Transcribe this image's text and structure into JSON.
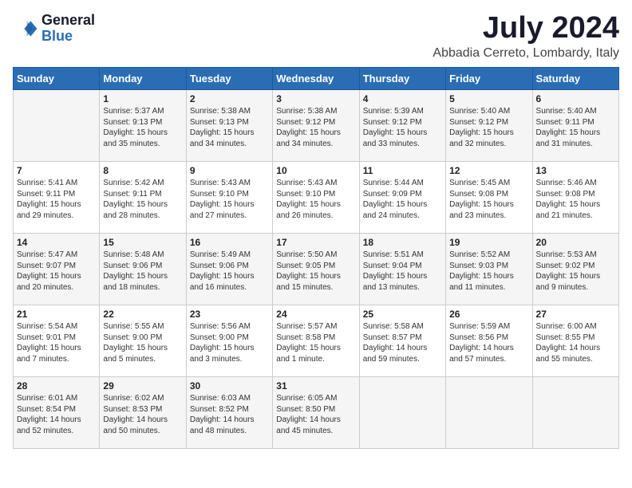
{
  "header": {
    "logo_general": "General",
    "logo_blue": "Blue",
    "month_year": "July 2024",
    "location": "Abbadia Cerreto, Lombardy, Italy"
  },
  "days_of_week": [
    "Sunday",
    "Monday",
    "Tuesday",
    "Wednesday",
    "Thursday",
    "Friday",
    "Saturday"
  ],
  "weeks": [
    [
      {
        "day": "",
        "info": ""
      },
      {
        "day": "1",
        "info": "Sunrise: 5:37 AM\nSunset: 9:13 PM\nDaylight: 15 hours\nand 35 minutes."
      },
      {
        "day": "2",
        "info": "Sunrise: 5:38 AM\nSunset: 9:13 PM\nDaylight: 15 hours\nand 34 minutes."
      },
      {
        "day": "3",
        "info": "Sunrise: 5:38 AM\nSunset: 9:12 PM\nDaylight: 15 hours\nand 34 minutes."
      },
      {
        "day": "4",
        "info": "Sunrise: 5:39 AM\nSunset: 9:12 PM\nDaylight: 15 hours\nand 33 minutes."
      },
      {
        "day": "5",
        "info": "Sunrise: 5:40 AM\nSunset: 9:12 PM\nDaylight: 15 hours\nand 32 minutes."
      },
      {
        "day": "6",
        "info": "Sunrise: 5:40 AM\nSunset: 9:11 PM\nDaylight: 15 hours\nand 31 minutes."
      }
    ],
    [
      {
        "day": "7",
        "info": "Sunrise: 5:41 AM\nSunset: 9:11 PM\nDaylight: 15 hours\nand 29 minutes."
      },
      {
        "day": "8",
        "info": "Sunrise: 5:42 AM\nSunset: 9:11 PM\nDaylight: 15 hours\nand 28 minutes."
      },
      {
        "day": "9",
        "info": "Sunrise: 5:43 AM\nSunset: 9:10 PM\nDaylight: 15 hours\nand 27 minutes."
      },
      {
        "day": "10",
        "info": "Sunrise: 5:43 AM\nSunset: 9:10 PM\nDaylight: 15 hours\nand 26 minutes."
      },
      {
        "day": "11",
        "info": "Sunrise: 5:44 AM\nSunset: 9:09 PM\nDaylight: 15 hours\nand 24 minutes."
      },
      {
        "day": "12",
        "info": "Sunrise: 5:45 AM\nSunset: 9:08 PM\nDaylight: 15 hours\nand 23 minutes."
      },
      {
        "day": "13",
        "info": "Sunrise: 5:46 AM\nSunset: 9:08 PM\nDaylight: 15 hours\nand 21 minutes."
      }
    ],
    [
      {
        "day": "14",
        "info": "Sunrise: 5:47 AM\nSunset: 9:07 PM\nDaylight: 15 hours\nand 20 minutes."
      },
      {
        "day": "15",
        "info": "Sunrise: 5:48 AM\nSunset: 9:06 PM\nDaylight: 15 hours\nand 18 minutes."
      },
      {
        "day": "16",
        "info": "Sunrise: 5:49 AM\nSunset: 9:06 PM\nDaylight: 15 hours\nand 16 minutes."
      },
      {
        "day": "17",
        "info": "Sunrise: 5:50 AM\nSunset: 9:05 PM\nDaylight: 15 hours\nand 15 minutes."
      },
      {
        "day": "18",
        "info": "Sunrise: 5:51 AM\nSunset: 9:04 PM\nDaylight: 15 hours\nand 13 minutes."
      },
      {
        "day": "19",
        "info": "Sunrise: 5:52 AM\nSunset: 9:03 PM\nDaylight: 15 hours\nand 11 minutes."
      },
      {
        "day": "20",
        "info": "Sunrise: 5:53 AM\nSunset: 9:02 PM\nDaylight: 15 hours\nand 9 minutes."
      }
    ],
    [
      {
        "day": "21",
        "info": "Sunrise: 5:54 AM\nSunset: 9:01 PM\nDaylight: 15 hours\nand 7 minutes."
      },
      {
        "day": "22",
        "info": "Sunrise: 5:55 AM\nSunset: 9:00 PM\nDaylight: 15 hours\nand 5 minutes."
      },
      {
        "day": "23",
        "info": "Sunrise: 5:56 AM\nSunset: 9:00 PM\nDaylight: 15 hours\nand 3 minutes."
      },
      {
        "day": "24",
        "info": "Sunrise: 5:57 AM\nSunset: 8:58 PM\nDaylight: 15 hours\nand 1 minute."
      },
      {
        "day": "25",
        "info": "Sunrise: 5:58 AM\nSunset: 8:57 PM\nDaylight: 14 hours\nand 59 minutes."
      },
      {
        "day": "26",
        "info": "Sunrise: 5:59 AM\nSunset: 8:56 PM\nDaylight: 14 hours\nand 57 minutes."
      },
      {
        "day": "27",
        "info": "Sunrise: 6:00 AM\nSunset: 8:55 PM\nDaylight: 14 hours\nand 55 minutes."
      }
    ],
    [
      {
        "day": "28",
        "info": "Sunrise: 6:01 AM\nSunset: 8:54 PM\nDaylight: 14 hours\nand 52 minutes."
      },
      {
        "day": "29",
        "info": "Sunrise: 6:02 AM\nSunset: 8:53 PM\nDaylight: 14 hours\nand 50 minutes."
      },
      {
        "day": "30",
        "info": "Sunrise: 6:03 AM\nSunset: 8:52 PM\nDaylight: 14 hours\nand 48 minutes."
      },
      {
        "day": "31",
        "info": "Sunrise: 6:05 AM\nSunset: 8:50 PM\nDaylight: 14 hours\nand 45 minutes."
      },
      {
        "day": "",
        "info": ""
      },
      {
        "day": "",
        "info": ""
      },
      {
        "day": "",
        "info": ""
      }
    ]
  ]
}
